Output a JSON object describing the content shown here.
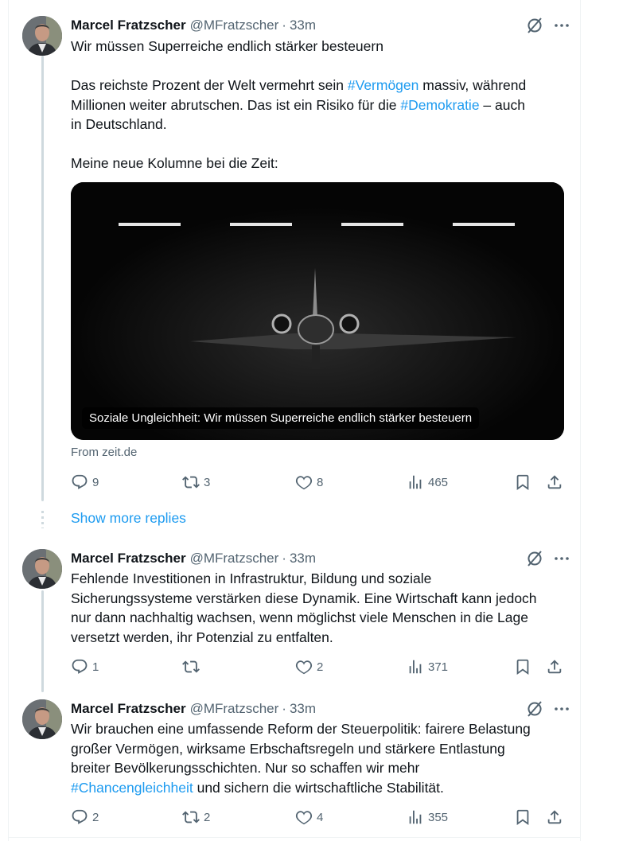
{
  "tweets": [
    {
      "name": "Marcel Fratzscher",
      "handle": "@MFratzscher",
      "sep": "·",
      "time": "33m",
      "lines": [
        {
          "t": "Wir müssen Superreiche endlich stärker besteuern"
        },
        {
          "a": "Das reichste Prozent der Welt vermehrt sein ",
          "h": "#Vermögen",
          "b": " massiv, während"
        },
        {
          "t": "Millionen weiter abrutschen. Das ist ein Risiko für die ",
          "h": "#Demokratie",
          "b": " – auch"
        },
        {
          "t": "in Deutschland."
        },
        {
          "t": "Meine neue Kolumne bei die Zeit:"
        }
      ],
      "media_caption": "Soziale Ungleichheit: Wir müssen Superreiche endlich stärker besteuern",
      "source": "From zeit.de",
      "replies": "9",
      "reposts": "3",
      "likes": "8",
      "views": "465"
    },
    {
      "name": "Marcel Fratzscher",
      "handle": "@MFratzscher",
      "sep": "·",
      "time": "33m",
      "text": [
        "Fehlende Investitionen in Infrastruktur, Bildung und soziale",
        "Sicherungssysteme verstärken diese Dynamik. Eine Wirtschaft kann jedoch",
        "nur dann nachhaltig wachsen, wenn möglichst viele Menschen in die Lage",
        "versetzt werden, ihr Potenzial zu entfalten."
      ],
      "replies": "1",
      "reposts": "",
      "likes": "2",
      "views": "371"
    },
    {
      "name": "Marcel Fratzscher",
      "handle": "@MFratzscher",
      "sep": "·",
      "time": "33m",
      "text": [
        "Wir brauchen eine umfassende Reform der Steuerpolitik: fairere Belastung",
        "großer Vermögen, wirksame Erbschaftsregeln und stärkere Entlastung",
        "breiter Bevölkerungsschichten. Nur so schaffen wir mehr"
      ],
      "last_hashtag": "#Chancengleichheit",
      "last_rest": " und sichern die wirtschaftliche Stabilität.",
      "replies": "2",
      "reposts": "2",
      "likes": "4",
      "views": "355"
    }
  ],
  "show_more": "Show more replies",
  "icons": [
    "grok-icon",
    "more-icon",
    "reply-icon",
    "repost-icon",
    "like-icon",
    "views-icon",
    "bookmark-icon",
    "share-icon"
  ],
  "colors": {
    "link": "#1d9bf0",
    "muted": "#536471",
    "text": "#0f1419",
    "thread": "#cfd9de"
  }
}
